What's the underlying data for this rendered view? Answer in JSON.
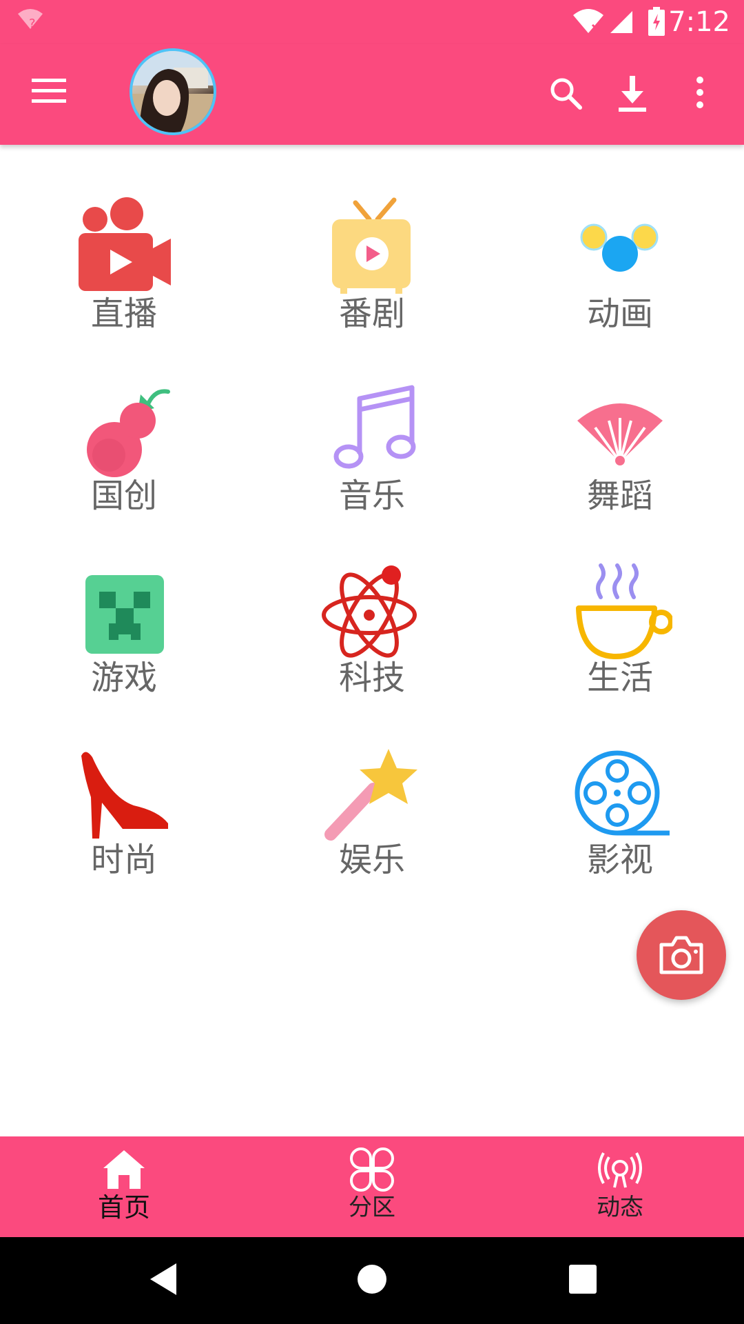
{
  "status_bar": {
    "time": "7:12",
    "icons": [
      "wifi-question-icon",
      "wifi-icon",
      "signal-icon",
      "battery-charging-icon"
    ]
  },
  "app_bar": {
    "icons": [
      "menu-icon",
      "avatar",
      "search-icon",
      "download-icon",
      "more-vert-icon"
    ]
  },
  "categories": [
    {
      "label": "直播",
      "icon": "live-camera-icon",
      "color": "#e84a4a"
    },
    {
      "label": "番剧",
      "icon": "tv-icon",
      "color": "#fcd36b"
    },
    {
      "label": "动画",
      "icon": "bubbles-icon",
      "color": "#1e9af0"
    },
    {
      "label": "国创",
      "icon": "gourd-icon",
      "color": "#f2577a"
    },
    {
      "label": "音乐",
      "icon": "music-note-icon",
      "color": "#b592f5"
    },
    {
      "label": "舞蹈",
      "icon": "fan-icon",
      "color": "#f76f8e"
    },
    {
      "label": "游戏",
      "icon": "creeper-icon",
      "color": "#56d093"
    },
    {
      "label": "科技",
      "icon": "atom-icon",
      "color": "#d7251f"
    },
    {
      "label": "生活",
      "icon": "coffee-cup-icon",
      "color": "#f7b600"
    },
    {
      "label": "时尚",
      "icon": "high-heel-icon",
      "color": "#d91d10"
    },
    {
      "label": "娱乐",
      "icon": "magic-wand-icon",
      "color": "#f7c63c"
    },
    {
      "label": "影视",
      "icon": "film-reel-icon",
      "color": "#1e9af0"
    }
  ],
  "fab": {
    "icon": "camera-icon"
  },
  "bottom_nav": {
    "items": [
      {
        "label": "首页",
        "icon": "home-icon",
        "active": true
      },
      {
        "label": "分区",
        "icon": "grid-petals-icon",
        "active": false
      },
      {
        "label": "动态",
        "icon": "broadcast-icon",
        "active": false
      }
    ]
  },
  "colors": {
    "primary": "#fb4a7e",
    "fab": "#e4565a",
    "label": "#666666"
  }
}
